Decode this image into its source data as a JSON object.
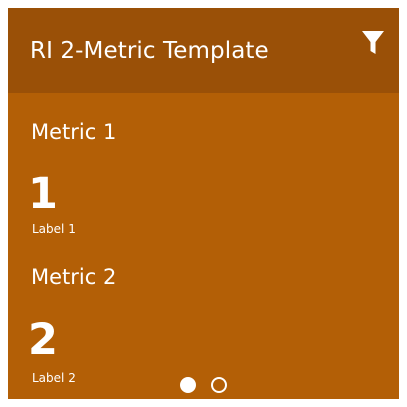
{
  "tile": {
    "title": "RI 2-Metric Template",
    "filter_icon": "filter-icon",
    "background_color": "#b35f06",
    "header_color": "#9a5007"
  },
  "metrics": [
    {
      "name": "Metric 1",
      "value": "1",
      "label": "Label 1"
    },
    {
      "name": "Metric 2",
      "value": "2",
      "label": "Label 2"
    }
  ],
  "pager": {
    "page_count": 2,
    "active_page": 1
  }
}
